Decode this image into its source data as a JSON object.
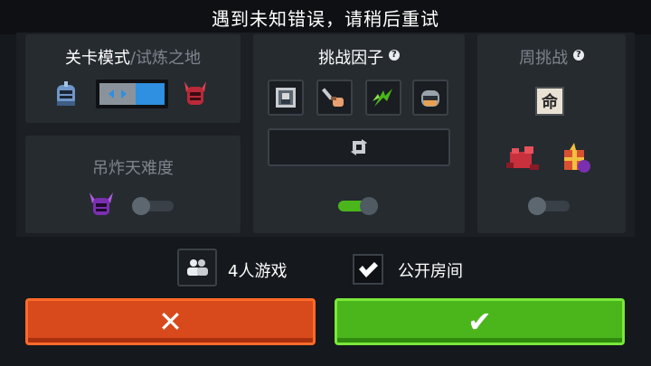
{
  "title": "遇到未知错误，请稍后重试",
  "mode_panel": {
    "title_main": "关卡模式",
    "title_sep": "/",
    "title_alt": "试炼之地"
  },
  "difficulty_panel": {
    "title": "吊炸天难度"
  },
  "challenge_panel": {
    "title": "挑战因子",
    "help": "?"
  },
  "weekly_panel": {
    "title": "周挑战",
    "help": "?",
    "badge_char": "命"
  },
  "options": {
    "players_label": "4人游戏",
    "public_room_label": "公开房间"
  },
  "buttons": {
    "cancel_glyph": "✕",
    "confirm_glyph": "✔"
  },
  "colors": {
    "cancel": "#d84a1c",
    "confirm": "#4bb61c",
    "toggle_on": "#4bb61c",
    "slider_accent": "#2f8fe0"
  }
}
